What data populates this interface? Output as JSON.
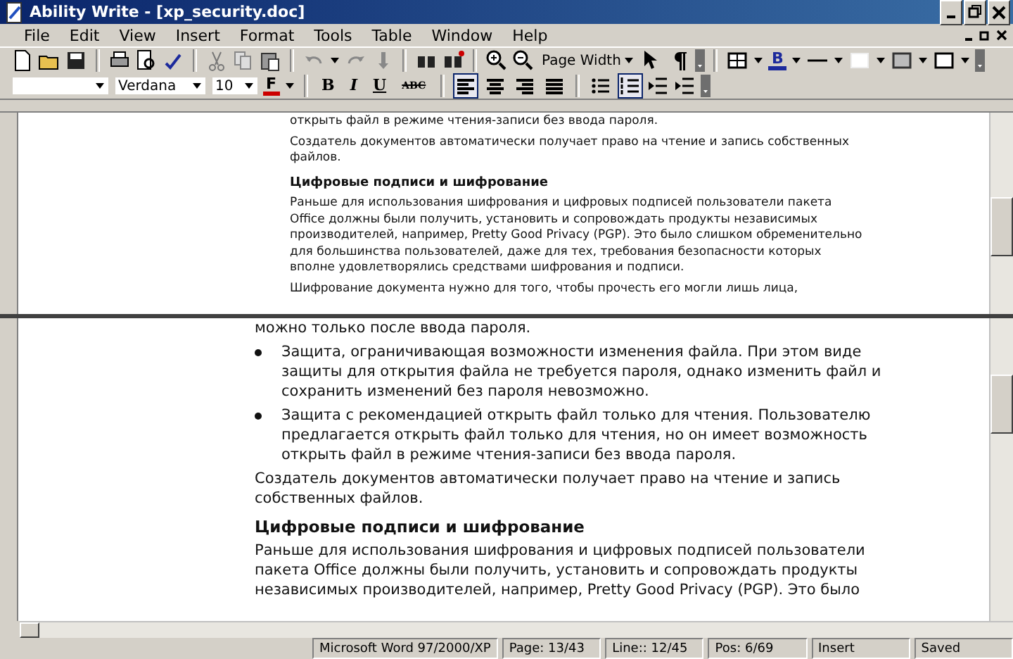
{
  "window": {
    "title": "Ability Write - [xp_security.doc]"
  },
  "menu": [
    "File",
    "Edit",
    "View",
    "Insert",
    "Format",
    "Tools",
    "Table",
    "Window",
    "Help"
  ],
  "toolbar": {
    "zoom": "Page Width",
    "border_color_label": "B"
  },
  "format_bar": {
    "font": "Verdana",
    "size": "10",
    "font_color_label": "F",
    "style_buttons": [
      {
        "label": "B",
        "kind": "bold"
      },
      {
        "label": "I",
        "kind": "italic"
      },
      {
        "label": "U",
        "kind": "underline"
      },
      {
        "label": "ABC",
        "kind": "strike"
      }
    ],
    "align_buttons": [
      {
        "kind": "left",
        "selected": true
      },
      {
        "kind": "center",
        "selected": false
      },
      {
        "kind": "right",
        "selected": false
      },
      {
        "kind": "justify",
        "selected": false
      }
    ],
    "list_buttons": [
      {
        "kind": "bullets",
        "selected": false
      },
      {
        "kind": "numbers",
        "selected": true
      }
    ]
  },
  "top_pane": {
    "paragraphs": [
      {
        "kind": "text",
        "text": "открыть файл в режиме чтения-записи без ввода пароля."
      },
      {
        "kind": "text",
        "text": "Создатель документов автоматически получает право на чтение и запись собственных файлов."
      },
      {
        "kind": "heading",
        "text": "Цифровые подписи и шифрование"
      },
      {
        "kind": "text",
        "text": "Раньше для использования шифрования и цифровых подписей пользователи пакета Office должны были получить, установить и сопровождать продукты независимых производителей, например, Pretty Good Privacy (PGP). Это было слишком обременительно для большинства пользователей, даже для тех, требования безопасности которых вполне удовлетворялись средствами шифрования и подписи."
      },
      {
        "kind": "text",
        "text": "Шифрование документа нужно для того, чтобы прочесть его могли лишь лица,"
      }
    ]
  },
  "bottom_pane": {
    "paragraphs": [
      {
        "kind": "text",
        "text": "можно только после ввода пароля."
      },
      {
        "kind": "bullet",
        "text": "Защита, ограничивающая возможности изменения файла. При этом виде защиты для открытия файла не требуется пароля, однако изменить файл и сохранить изменений без пароля невозможно."
      },
      {
        "kind": "bullet",
        "text": "Защита с рекомендацией открыть файл только для чтения. Пользователю предлагается открыть файл только для чтения, но он имеет возможность открыть файл в режиме чтения-записи без ввода пароля."
      },
      {
        "kind": "text",
        "text": "Создатель документов автоматически получает право на чтение и запись собственных файлов."
      },
      {
        "kind": "heading",
        "text": "Цифровые подписи и шифрование"
      },
      {
        "kind": "text",
        "text": "Раньше для использования шифрования и цифровых подписей пользователи пакета Office должны были получить, установить и сопровождать продукты независимых производителей, например, Pretty Good Privacy (PGP). Это было"
      }
    ]
  },
  "status_bar": [
    "Microsoft Word 97/2000/XP",
    "Page: 13/43",
    "Line:: 12/45",
    "Pos: 6/69",
    "Insert",
    "Saved"
  ]
}
